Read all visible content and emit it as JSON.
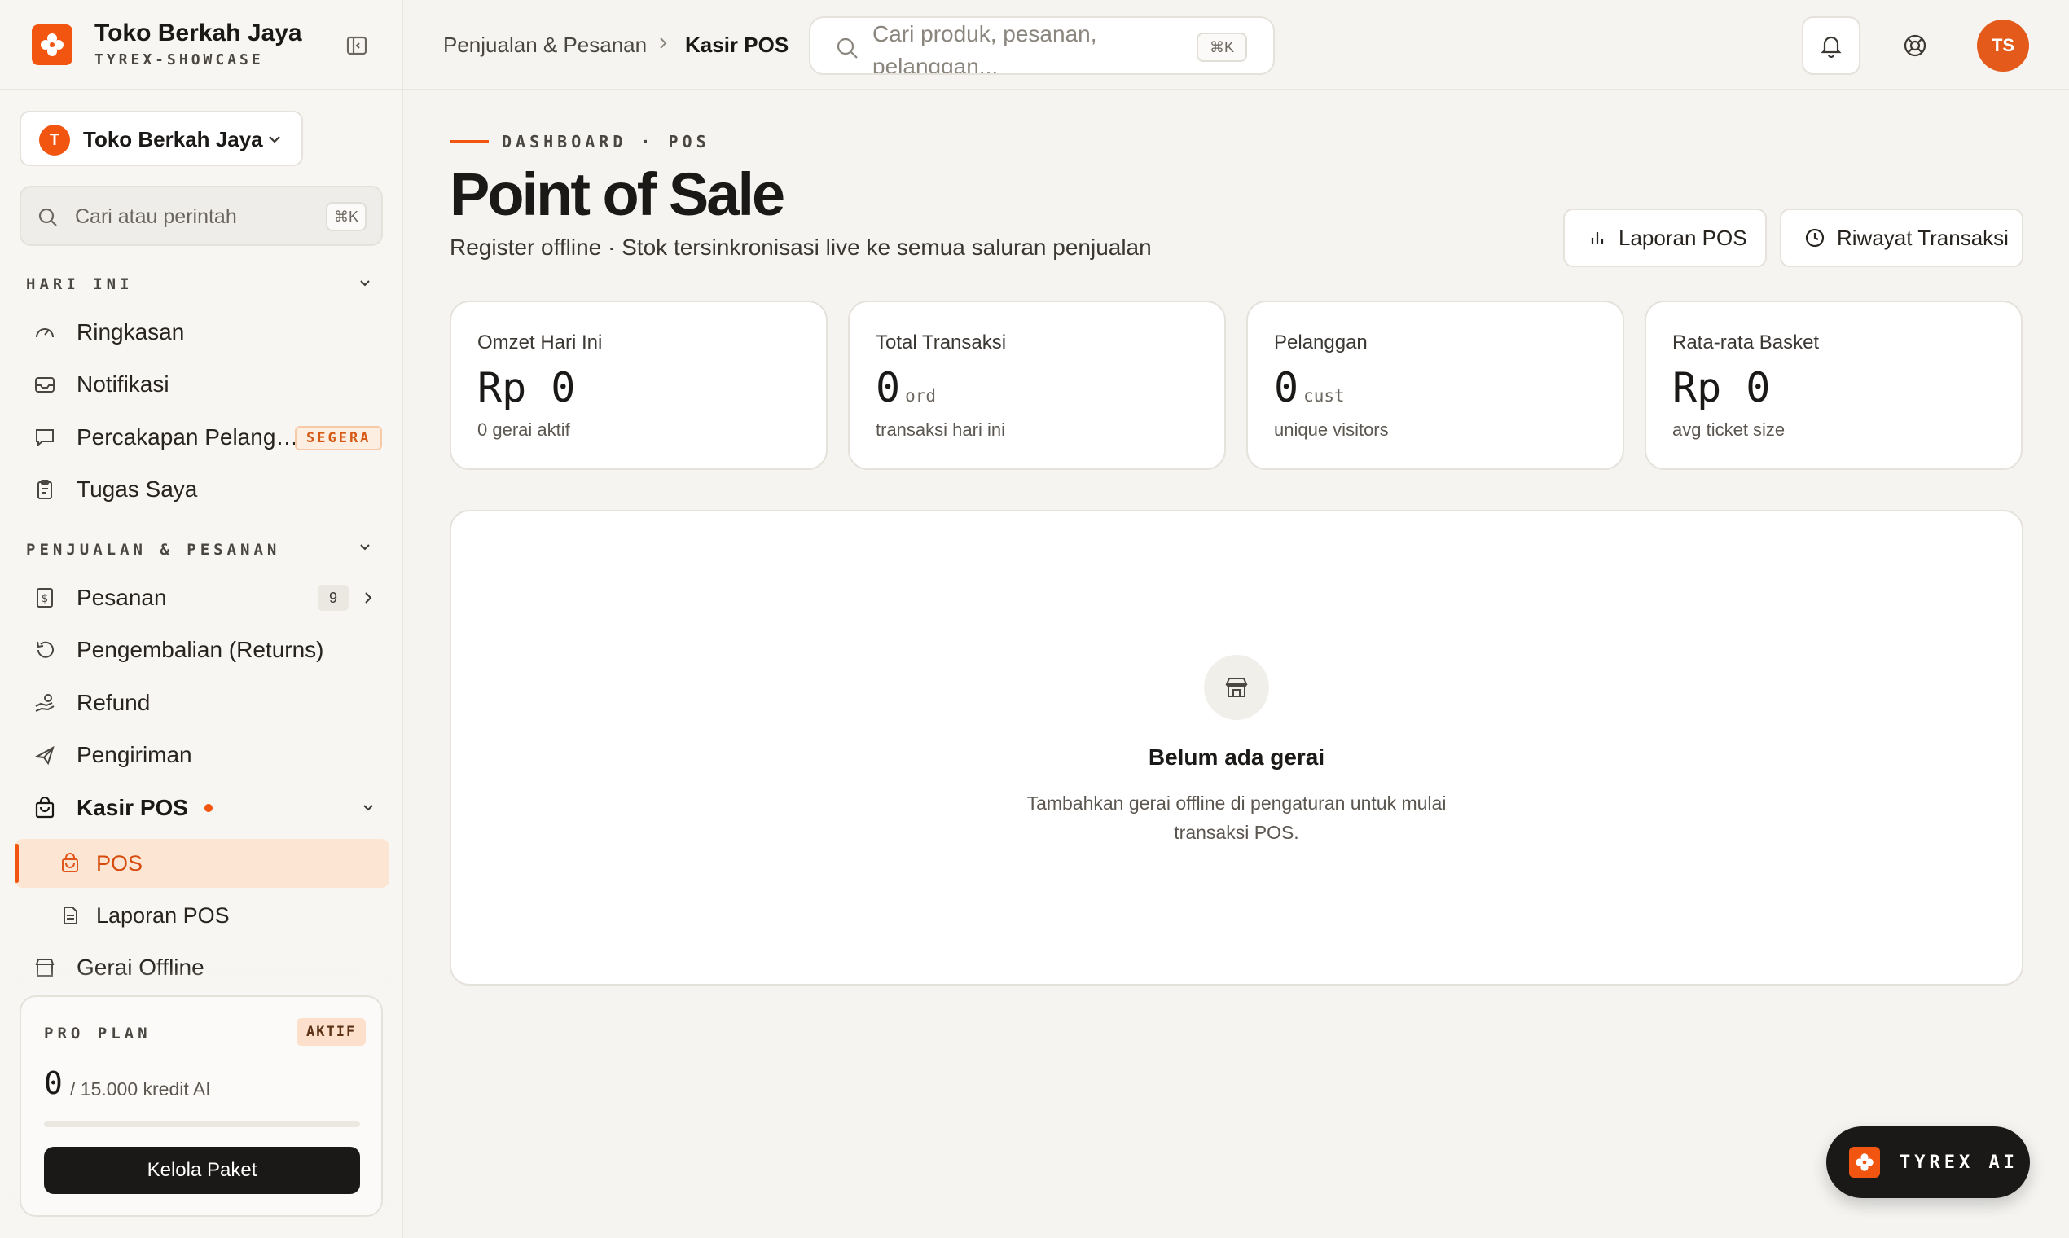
{
  "brand": {
    "name": "Toko Berkah Jaya",
    "subtitle": "TYREX-SHOWCASE",
    "accent": "#f2550f"
  },
  "store_switcher": {
    "initial": "T",
    "name": "Toko Berkah Jaya"
  },
  "sidebar_search": {
    "placeholder": "Cari atau perintah",
    "shortcut": "⌘K"
  },
  "sections": {
    "today": "HARI INI",
    "sales": "PENJUALAN & PESANAN"
  },
  "nav_today": [
    {
      "label": "Ringkasan",
      "icon": "gauge-icon"
    },
    {
      "label": "Notifikasi",
      "icon": "inbox-icon"
    },
    {
      "label": "Percakapan Pelang…",
      "icon": "chat-icon",
      "badge": "SEGERA"
    },
    {
      "label": "Tugas Saya",
      "icon": "clipboard-icon"
    }
  ],
  "nav_sales": [
    {
      "label": "Pesanan",
      "icon": "receipt-icon",
      "count": "9"
    },
    {
      "label": "Pengembalian (Returns)",
      "icon": "undo-icon"
    },
    {
      "label": "Refund",
      "icon": "hand-coin-icon"
    },
    {
      "label": "Pengiriman",
      "icon": "plane-icon"
    },
    {
      "label": "Kasir POS",
      "icon": "shopping-bag-icon"
    }
  ],
  "nav_pos_sub": [
    {
      "label": "POS",
      "icon": "bag-icon",
      "active": true
    },
    {
      "label": "Laporan POS",
      "icon": "document-icon"
    }
  ],
  "nav_partial": {
    "label": "Gerai Offline",
    "icon": "store-icon"
  },
  "plan": {
    "title": "PRO PLAN",
    "status": "AKTIF",
    "used": "0",
    "of_label": "/ 15.000 kredit AI",
    "usage_fraction": 0,
    "button": "Kelola Paket"
  },
  "topbar": {
    "crumb_parent": "Penjualan & Pesanan",
    "crumb_current": "Kasir POS",
    "search_placeholder": "Cari produk, pesanan, pelanggan...",
    "search_shortcut": "⌘K",
    "avatar_initials": "TS"
  },
  "page": {
    "eyebrow": "DASHBOARD · POS",
    "title": "Point of Sale",
    "subtitle": "Register offline · Stok tersinkronisasi live ke semua saluran penjualan",
    "actions": {
      "report": "Laporan POS",
      "history": "Riwayat Transaksi"
    }
  },
  "stats": [
    {
      "label": "Omzet Hari Ini",
      "value": "Rp 0",
      "unit": "",
      "note": "0 gerai aktif"
    },
    {
      "label": "Total Transaksi",
      "value": "0",
      "unit": "ord",
      "note": "transaksi hari ini"
    },
    {
      "label": "Pelanggan",
      "value": "0",
      "unit": "cust",
      "note": "unique visitors"
    },
    {
      "label": "Rata-rata Basket",
      "value": "Rp 0",
      "unit": "",
      "note": "avg ticket size"
    }
  ],
  "empty_state": {
    "title": "Belum ada gerai",
    "description": "Tambahkan gerai offline di pengaturan untuk mulai transaksi POS."
  },
  "ai_button": {
    "label": "TYREX AI"
  }
}
